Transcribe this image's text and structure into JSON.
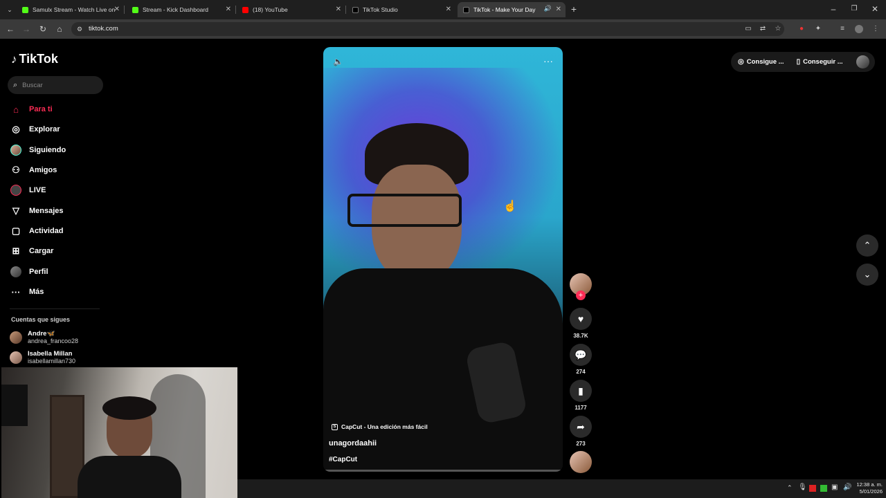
{
  "browser": {
    "tabs": [
      {
        "label": "Samulx Stream - Watch Live on",
        "fav_color": "#53fc18"
      },
      {
        "label": "Stream - Kick Dashboard",
        "fav_color": "#53fc18"
      },
      {
        "label": "(18) YouTube",
        "fav_color": "#ff0000"
      },
      {
        "label": "TikTok Studio",
        "fav_color": "#000000"
      },
      {
        "label": "TikTok - Make Your Day",
        "fav_color": "#000000"
      }
    ],
    "url": "tiktok.com"
  },
  "sidebar": {
    "logo": "TikTok",
    "search_placeholder": "Buscar",
    "nav": [
      {
        "label": "Para ti",
        "icon": "home-icon"
      },
      {
        "label": "Explorar",
        "icon": "compass-icon"
      },
      {
        "label": "Siguiendo",
        "icon": "following-avatar-icon"
      },
      {
        "label": "Amigos",
        "icon": "friends-icon"
      },
      {
        "label": "LIVE",
        "icon": "live-icon"
      },
      {
        "label": "Mensajes",
        "icon": "messages-icon"
      },
      {
        "label": "Actividad",
        "icon": "activity-icon"
      },
      {
        "label": "Cargar",
        "icon": "upload-icon"
      },
      {
        "label": "Perfil",
        "icon": "profile-icon"
      },
      {
        "label": "Más",
        "icon": "more-icon"
      }
    ],
    "following_title": "Cuentas que sigues",
    "accounts": [
      {
        "name": "Andre🦋",
        "username": "andrea_francoo28"
      },
      {
        "name": "Isabella Millan",
        "username": "isabellamillan730"
      }
    ]
  },
  "video": {
    "capcut_label": "CapCut - Una edición más fácil",
    "username": "unagordaahii",
    "hashtag": "#CapCut"
  },
  "actions": {
    "likes": "38.7K",
    "comments": "274",
    "saves": "1177",
    "shares": "273"
  },
  "topright": {
    "btn1": "Consigue ...",
    "btn2": "Conseguir ..."
  },
  "taskbar": {
    "time": "12:38 a. m.",
    "date": "5/01/2026"
  },
  "colors": {
    "accent": "#fe2c55"
  }
}
